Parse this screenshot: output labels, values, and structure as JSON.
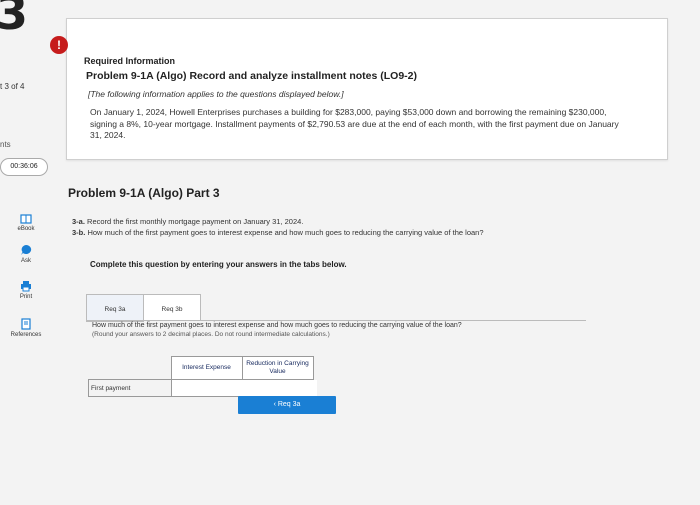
{
  "sidebar": {
    "question_digit": "3",
    "question_of": "t 3 of 4",
    "points": "nts",
    "timer": "00:36:06",
    "items": [
      {
        "label": "eBook",
        "icon": "book-icon"
      },
      {
        "label": "Ask",
        "icon": "chat-icon"
      },
      {
        "label": "Print",
        "icon": "printer-icon"
      },
      {
        "label": "References",
        "icon": "references-icon"
      }
    ]
  },
  "info": {
    "alert_icon": "!",
    "heading": "Required Information",
    "problem_title": "Problem 9-1A (Algo) Record and analyze installment notes (LO9-2)",
    "note": "[The following information applies to the questions displayed below.]",
    "paragraph": "On January 1, 2024, Howell Enterprises purchases a building for $283,000, paying $53,000 down and borrowing the remaining $230,000, signing a 8%, 10-year mortgage. Installment payments of $2,790.53 are due at the end of each month, with the first payment due on January 31, 2024."
  },
  "part": {
    "title": "Problem 9-1A (Algo) Part 3",
    "q_a_label": "3-a.",
    "q_a_text": "Record the first monthly mortgage payment on January 31, 2024.",
    "q_b_label": "3-b.",
    "q_b_text": "How much of the first payment goes to interest expense and how much goes to reducing the carrying value of the loan?",
    "instructions": "Complete this question by entering your answers in the tabs below."
  },
  "tabs": [
    {
      "label": "Req 3a",
      "active": false
    },
    {
      "label": "Req 3b",
      "active": true
    }
  ],
  "panel": {
    "question": "How much of the first payment goes to interest expense and how much goes to reducing the carrying value of the loan?",
    "hint": "(Round your answers to 2 decimal places. Do not round intermediate calculations.)",
    "col_interest": "Interest Expense",
    "col_reduction": "Reduction in Carrying Value",
    "row_label": "First payment",
    "interest_value": "",
    "reduction_value": ""
  },
  "nav": {
    "prev_label": "‹  Req 3a"
  },
  "colors": {
    "alert": "#c61c1c",
    "button": "#1a7fd4",
    "header_text": "#1a2c60"
  }
}
